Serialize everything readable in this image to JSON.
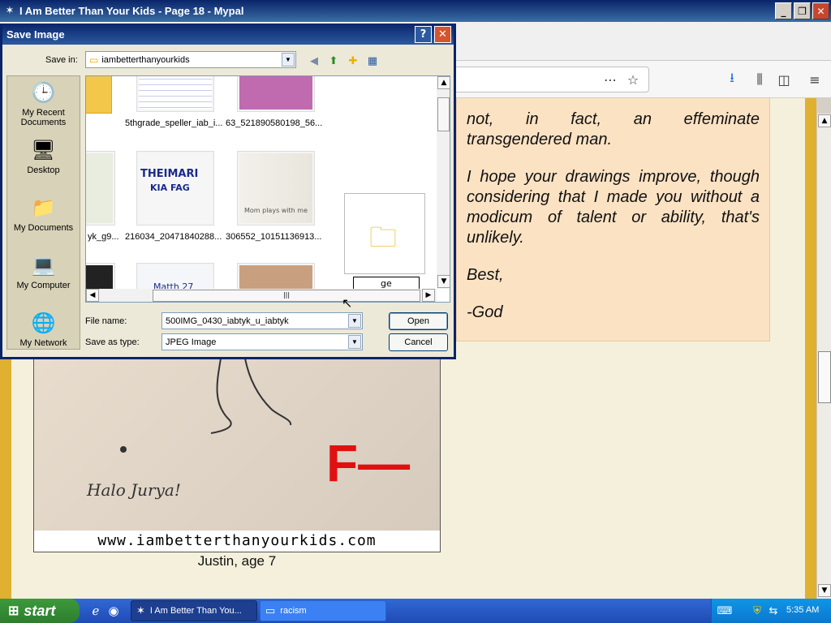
{
  "window": {
    "title": "I Am Better Than Your Kids - Page 18 - Mypal",
    "minimize": "_",
    "maximize": "❐",
    "close": "✕"
  },
  "letter": {
    "line1": "not, in fact, an effeminate",
    "line2": "transgendered man.",
    "para2": "I hope your drawings improve, though considering that I made you without a modicum of talent or ability, that's unlikely.",
    "sign1": "Best,",
    "sign2": "-God"
  },
  "image": {
    "text_halo": "Halo Jurya!",
    "grade": "F—",
    "site": "www.iambetterthanyourkids.com",
    "caption": "Justin, age 7"
  },
  "dialog": {
    "title": "Save Image",
    "help": "?",
    "close": "✕",
    "save_in_label": "Save in:",
    "save_in_value": "iambetterthanyourkids",
    "places": [
      {
        "label": "My Recent Documents"
      },
      {
        "label": "Desktop"
      },
      {
        "label": "My Documents"
      },
      {
        "label": "My Computer"
      },
      {
        "label": "My Network"
      }
    ],
    "files": {
      "f1": "5thgrade_speller_iab_i...",
      "f2": "63_521890580198_56...",
      "f3": "yk_g9...",
      "f4": "216034_20471840288...",
      "f5": "306552_10151136913...",
      "thumb_text_1": "THEIMARI",
      "thumb_text_2": "KIA FAG",
      "thumb_text_3": "Mom plays with me",
      "thumb_text_4": "Matth 27",
      "rename_value": "ge"
    },
    "file_name_label": "File name:",
    "file_name_value": "500IMG_0430_iabtyk_u_iabtyk",
    "save_as_label": "Save as type:",
    "save_as_value": "JPEG Image",
    "open_button": "Open",
    "cancel_button": "Cancel"
  },
  "taskbar": {
    "start": "start",
    "tasks": [
      {
        "label": "I Am Better Than You..."
      },
      {
        "label": "racism"
      }
    ],
    "clock": "5:35 AM"
  }
}
